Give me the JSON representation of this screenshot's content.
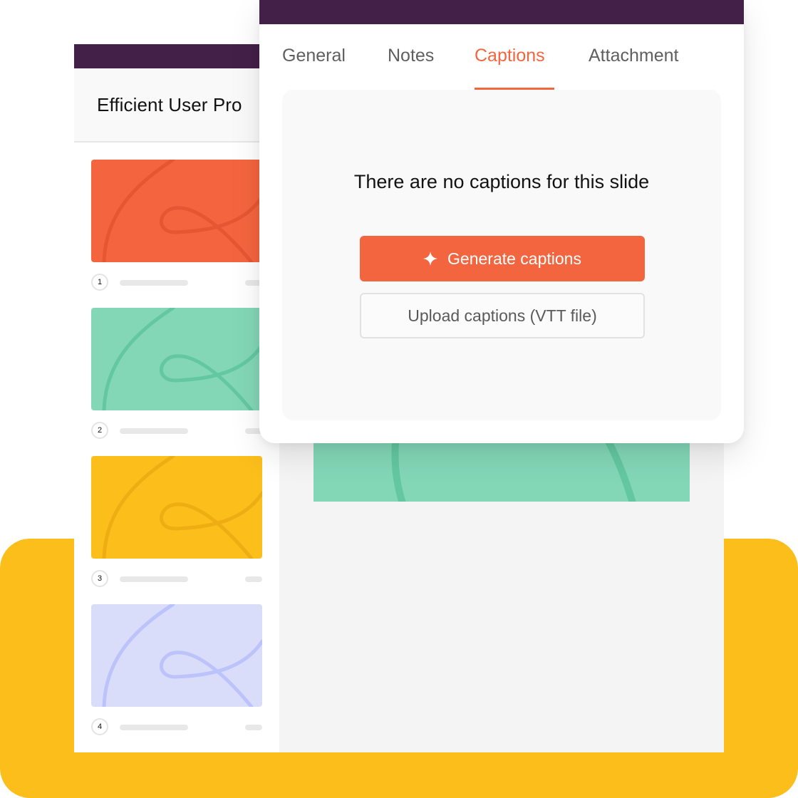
{
  "app": {
    "presentation_title": "Efficient User Pro"
  },
  "slides": [
    {
      "number": "1",
      "color": "#F4653F",
      "stroke": "#E75633"
    },
    {
      "number": "2",
      "color": "#83D7B7",
      "stroke": "#63C8A1"
    },
    {
      "number": "3",
      "color": "#FCBE1A",
      "stroke": "#EEAD12"
    },
    {
      "number": "4",
      "color": "#DADDFA",
      "stroke": "#BCC2FA"
    }
  ],
  "canvas": {
    "active_slide_color": "#83D7B7",
    "active_slide_stroke": "#63C8A1"
  },
  "panel": {
    "tabs": [
      {
        "label": "General",
        "active": false
      },
      {
        "label": "Notes",
        "active": false
      },
      {
        "label": "Captions",
        "active": true
      },
      {
        "label": "Attachment",
        "active": false
      }
    ],
    "empty_message": "There are no captions for this slide",
    "generate_button": {
      "label": "Generate captions",
      "icon": "sparkle-icon"
    },
    "upload_button": {
      "label": "Upload captions (VTT file)"
    }
  },
  "colors": {
    "accent": "#F3653F",
    "header_bar": "#432048",
    "backdrop": "#FCBE1A"
  }
}
